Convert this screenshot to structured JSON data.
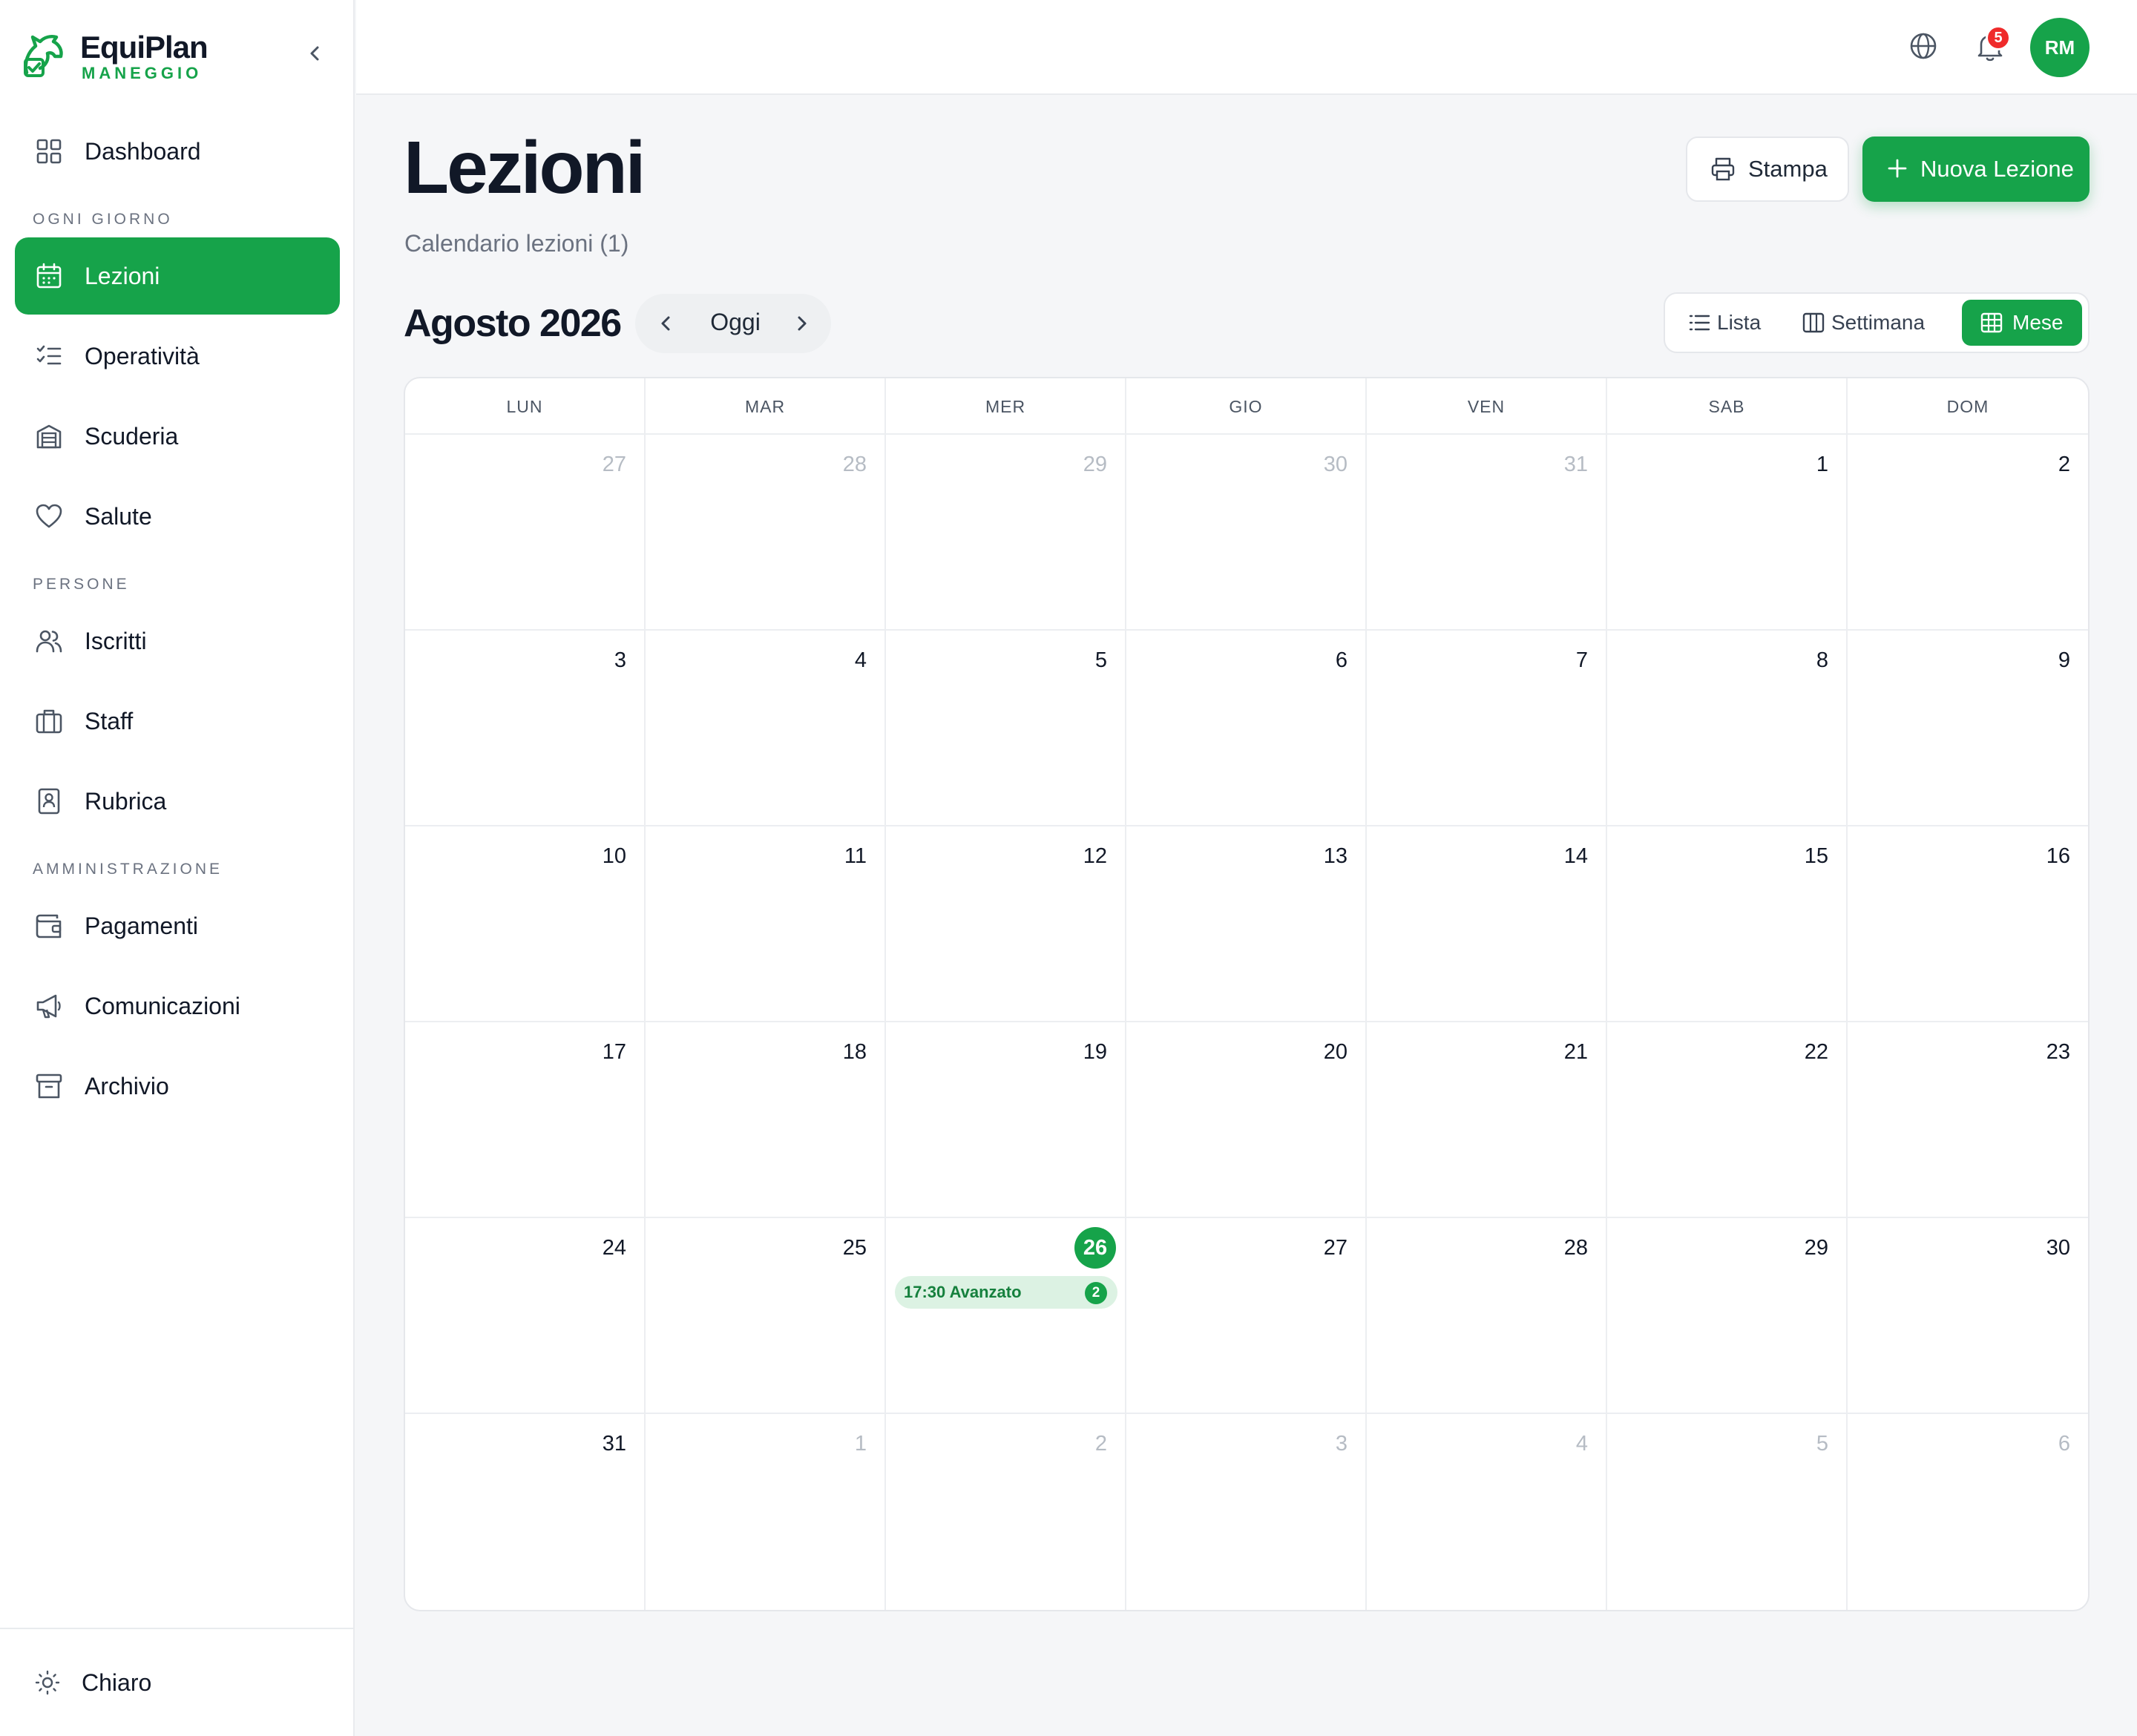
{
  "brand": {
    "name": "EquiPlan",
    "subtitle": "MANEGGIO"
  },
  "sidebar": {
    "dashboard": "Dashboard",
    "section_daily": "OGNI GIORNO",
    "lezioni": "Lezioni",
    "operativita": "Operatività",
    "scuderia": "Scuderia",
    "salute": "Salute",
    "section_people": "PERSONE",
    "iscritti": "Iscritti",
    "staff": "Staff",
    "rubrica": "Rubrica",
    "section_admin": "AMMINISTRAZIONE",
    "pagamenti": "Pagamenti",
    "comunicazioni": "Comunicazioni",
    "archivio": "Archivio",
    "theme_label": "Chiaro"
  },
  "topbar": {
    "notifications_count": "5",
    "user_initials": "RM"
  },
  "header": {
    "title": "Lezioni",
    "subtitle": "Calendario lezioni (1)",
    "print_label": "Stampa",
    "new_label": "Nuova Lezione"
  },
  "calendar": {
    "month_label": "Agosto 2026",
    "today_label": "Oggi",
    "views": {
      "list": "Lista",
      "week": "Settimana",
      "month": "Mese"
    },
    "active_view": "Mese",
    "weekdays": [
      "LUN",
      "MAR",
      "MER",
      "GIO",
      "VEN",
      "SAB",
      "DOM"
    ],
    "days": [
      {
        "n": "27",
        "other": true
      },
      {
        "n": "28",
        "other": true
      },
      {
        "n": "29",
        "other": true
      },
      {
        "n": "30",
        "other": true
      },
      {
        "n": "31",
        "other": true
      },
      {
        "n": "1"
      },
      {
        "n": "2"
      },
      {
        "n": "3"
      },
      {
        "n": "4"
      },
      {
        "n": "5"
      },
      {
        "n": "6"
      },
      {
        "n": "7"
      },
      {
        "n": "8"
      },
      {
        "n": "9"
      },
      {
        "n": "10"
      },
      {
        "n": "11"
      },
      {
        "n": "12"
      },
      {
        "n": "13"
      },
      {
        "n": "14"
      },
      {
        "n": "15"
      },
      {
        "n": "16"
      },
      {
        "n": "17"
      },
      {
        "n": "18"
      },
      {
        "n": "19"
      },
      {
        "n": "20"
      },
      {
        "n": "21"
      },
      {
        "n": "22"
      },
      {
        "n": "23"
      },
      {
        "n": "24"
      },
      {
        "n": "25"
      },
      {
        "n": "26",
        "today": true,
        "events": [
          {
            "time": "17:30",
            "title": "Avanzato",
            "count": "2"
          }
        ]
      },
      {
        "n": "27"
      },
      {
        "n": "28"
      },
      {
        "n": "29"
      },
      {
        "n": "30"
      },
      {
        "n": "31"
      },
      {
        "n": "1",
        "other": true
      },
      {
        "n": "2",
        "other": true
      },
      {
        "n": "3",
        "other": true
      },
      {
        "n": "4",
        "other": true
      },
      {
        "n": "5",
        "other": true
      },
      {
        "n": "6",
        "other": true
      }
    ]
  },
  "colors": {
    "accent": "#16a34a",
    "badge": "#ef2b2b",
    "event_bg": "#dcf2e3"
  }
}
